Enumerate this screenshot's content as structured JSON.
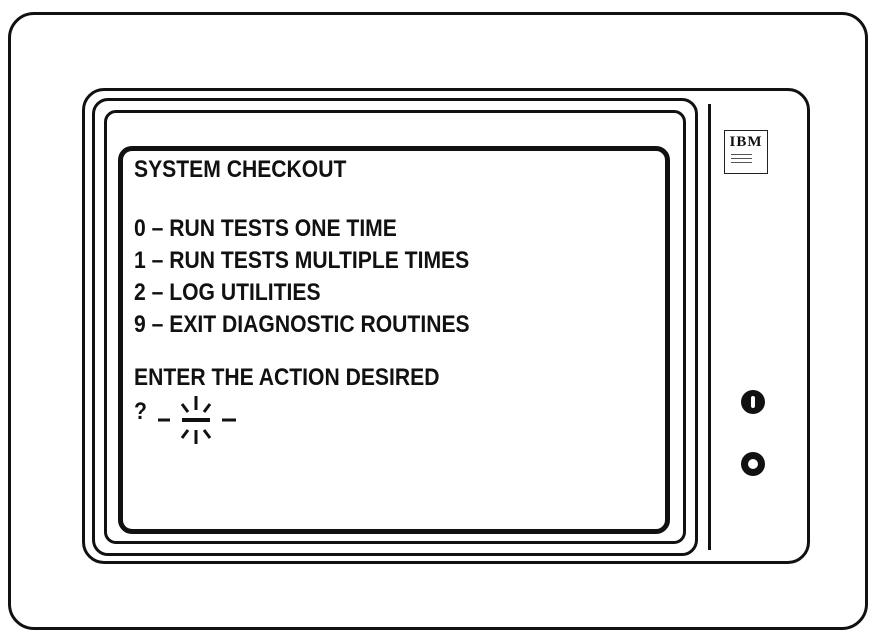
{
  "monitor": {
    "badge_brand": "IBM",
    "icons": [
      "power-knob",
      "brightness-knob"
    ]
  },
  "screen": {
    "title": "SYSTEM CHECKOUT",
    "options": [
      "0 – RUN TESTS ONE TIME",
      "1 – RUN TESTS MULTIPLE TIMES",
      "2 – LOG UTILITIES",
      "9 – EXIT DIAGNOSTIC ROUTINES"
    ],
    "prompt": "ENTER THE ACTION DESIRED",
    "input_prefix": "?"
  }
}
